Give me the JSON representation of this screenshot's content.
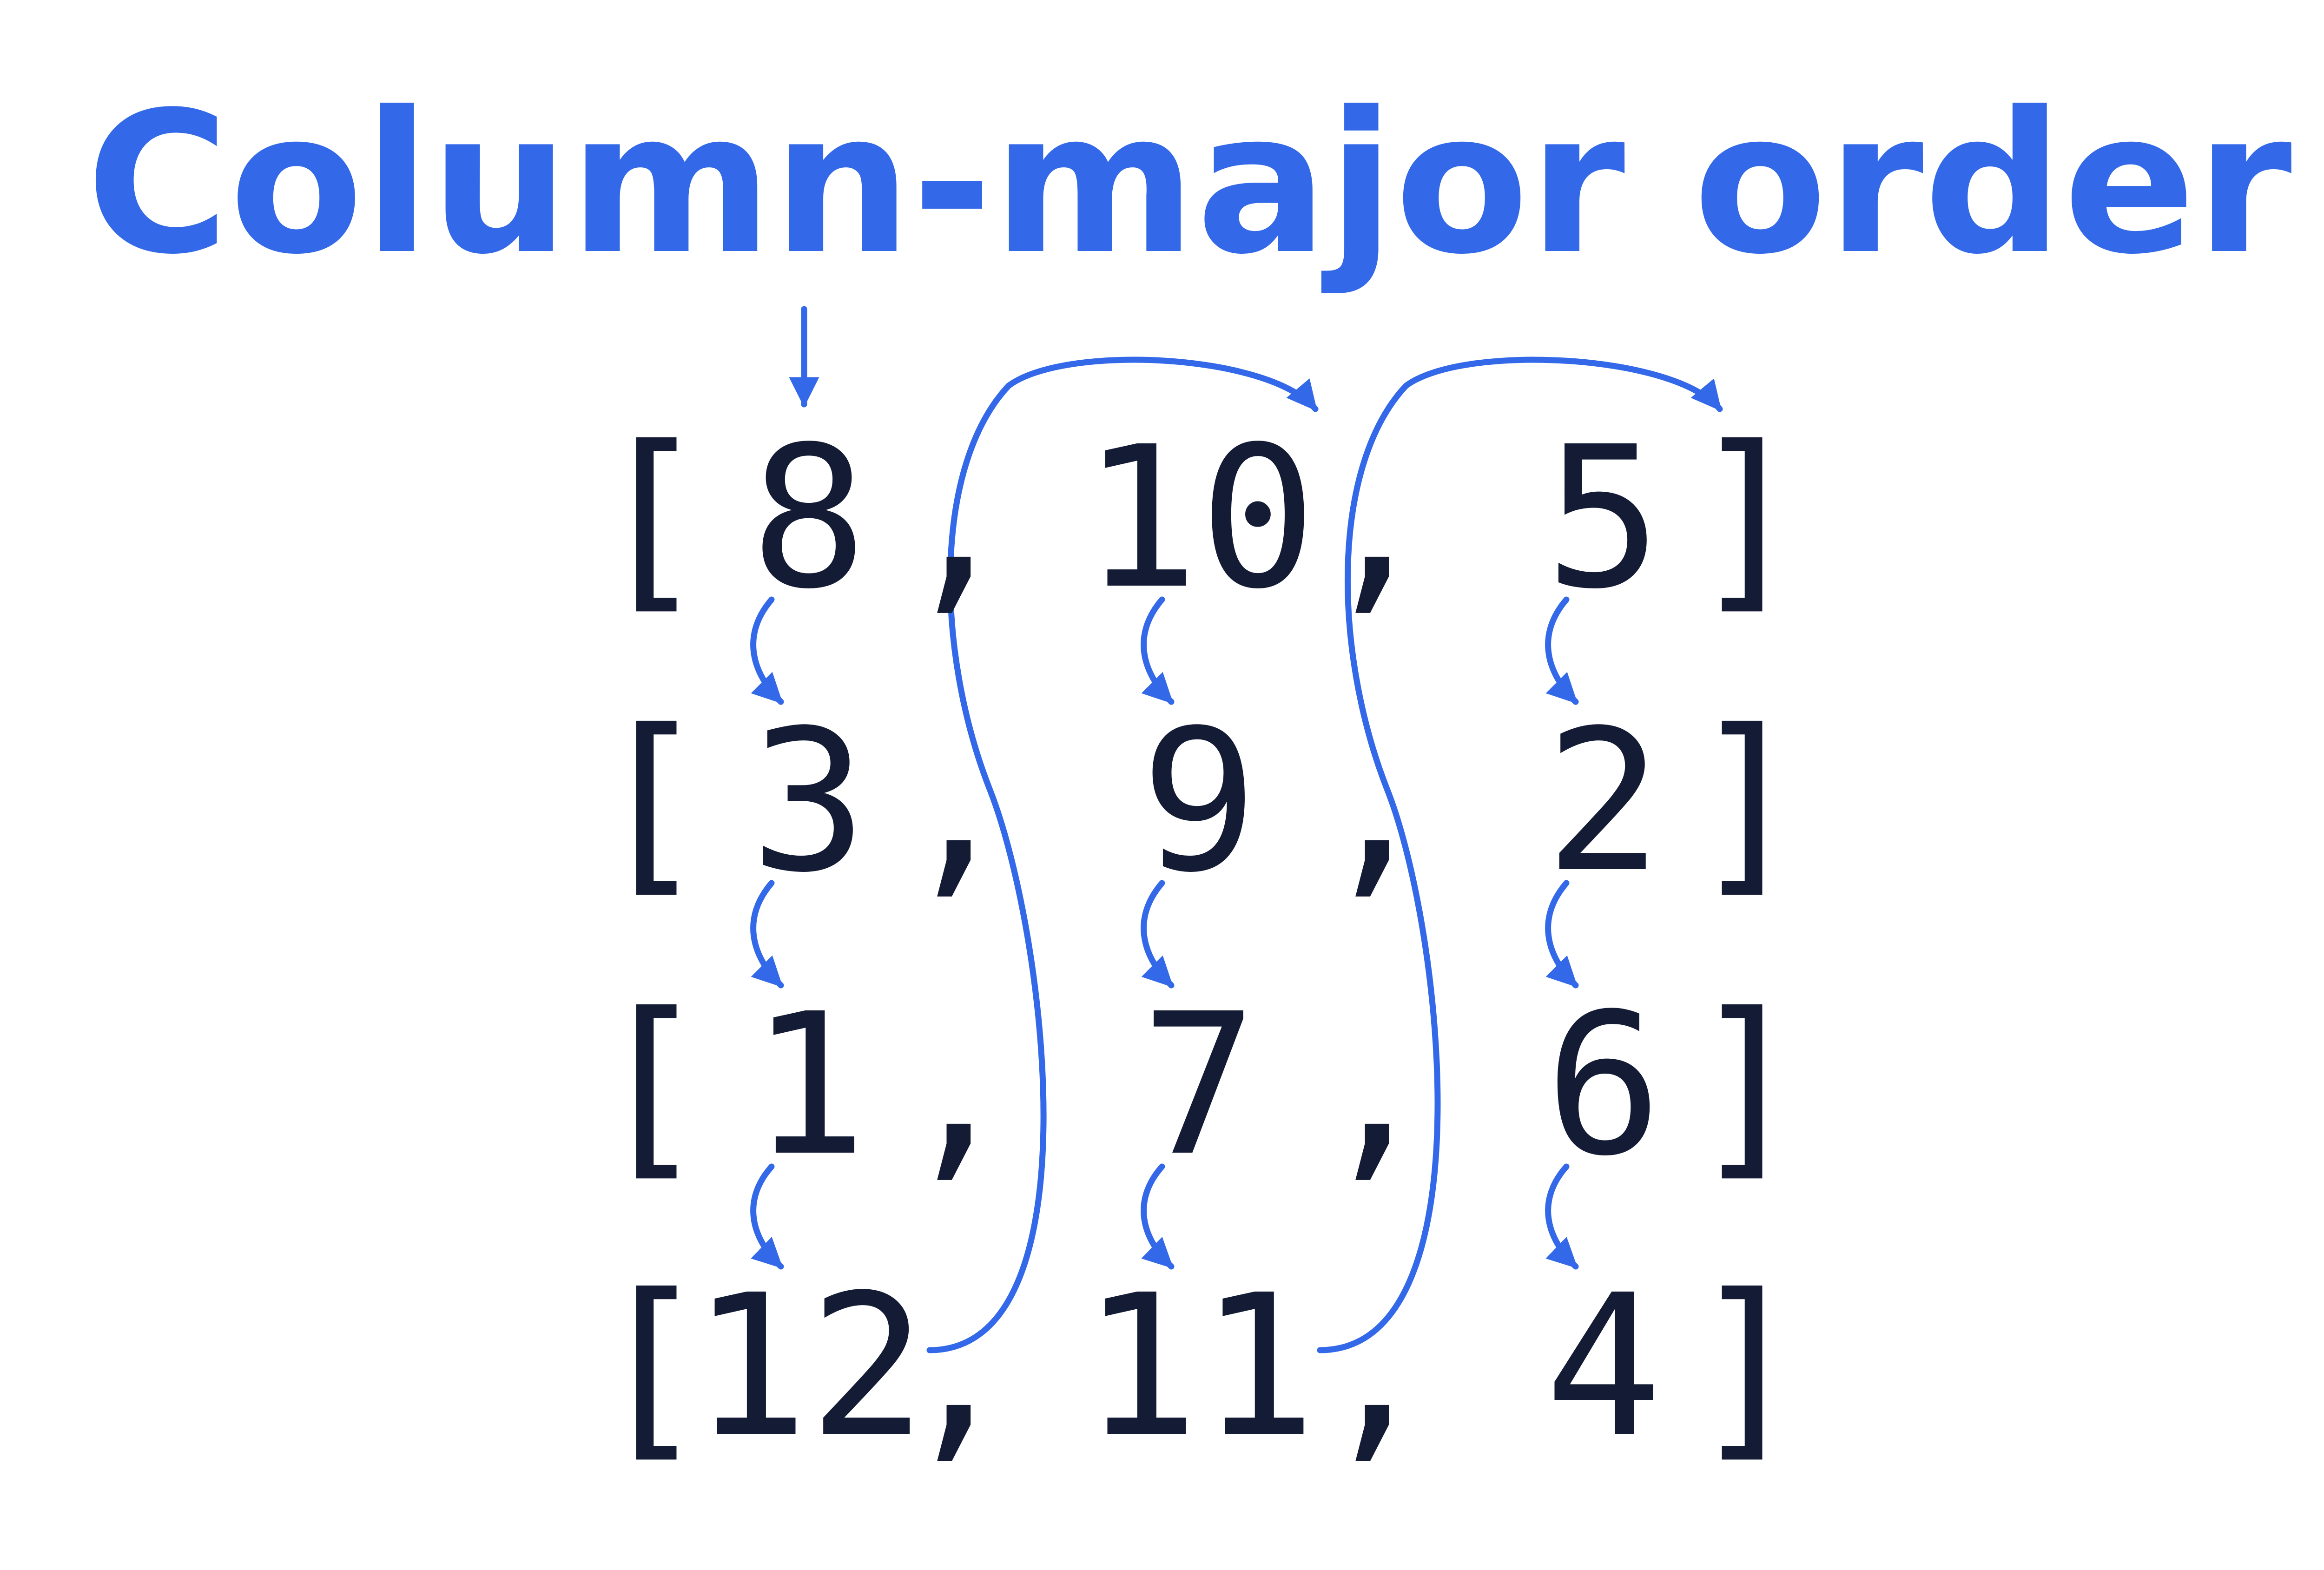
{
  "title": "Column-major order",
  "matrix": {
    "rows": [
      [
        "8",
        "10",
        "5"
      ],
      [
        "3",
        "9",
        "2"
      ],
      [
        "1",
        "7",
        "6"
      ],
      [
        "12",
        "11",
        "4"
      ]
    ],
    "open_bracket": "[",
    "close_bracket": "]",
    "separator": ","
  },
  "colors": {
    "accent": "#3369E8",
    "text": "#141B34",
    "background": "#FFFFFF"
  }
}
